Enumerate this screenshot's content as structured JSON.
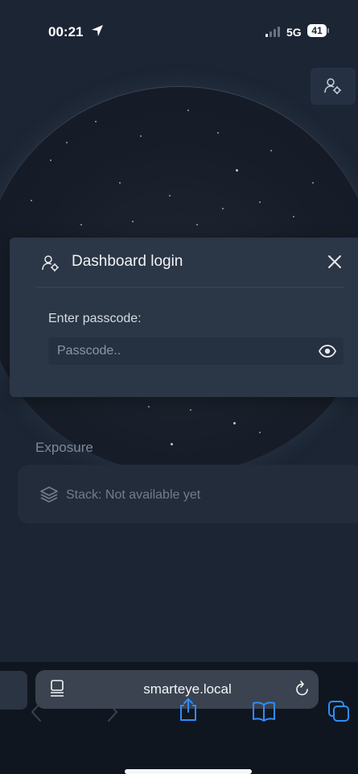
{
  "status_bar": {
    "time": "00:21",
    "network": "5G",
    "battery": "41"
  },
  "modal": {
    "title": "Dashboard login",
    "passcode_label": "Enter passcode:",
    "passcode_placeholder": "Passcode.."
  },
  "main": {
    "section_title": "Exposure",
    "stack_status": "Stack: Not available yet"
  },
  "browser": {
    "url": "smarteye.local"
  },
  "icons": {
    "user_config": "user-cog-icon",
    "close": "close-icon",
    "eye": "eye-icon",
    "stack": "layers-icon",
    "share": "share-icon",
    "bookmarks": "book-icon",
    "tabs": "tabs-icon"
  },
  "colors": {
    "background": "#1b2533",
    "modal": "#2b3646",
    "accent_blue": "#2f8cff"
  }
}
